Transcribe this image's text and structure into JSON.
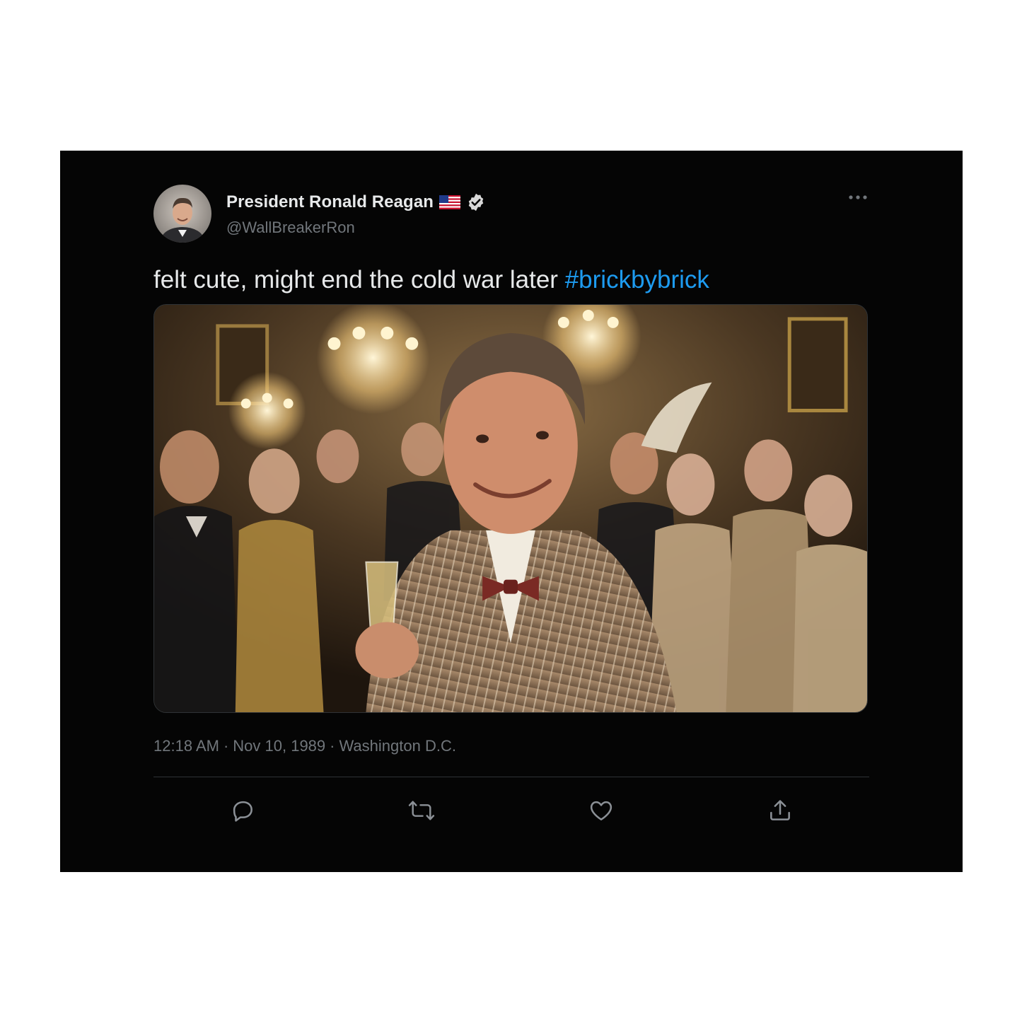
{
  "tweet": {
    "author": {
      "display_name": "President Ronald Reagan",
      "handle": "@WallBreakerRon",
      "flag_icon": "us-flag-icon",
      "verified_icon": "verified-badge-icon"
    },
    "text": "felt cute, might end the cold war later",
    "hashtag": "#brickbybrick",
    "meta": {
      "time": "12:18 AM",
      "separator": "·",
      "date": "Nov 10, 1989",
      "location": "Washington D.C."
    },
    "actions": [
      "reply-icon",
      "retweet-icon",
      "like-icon",
      "share-icon"
    ],
    "more_icon": "more-options-icon"
  },
  "colors": {
    "background": "#050505",
    "primary_text": "#e7e9ea",
    "secondary_text": "#71767b",
    "hashtag": "#1d9bf0",
    "divider": "#2f3336"
  }
}
